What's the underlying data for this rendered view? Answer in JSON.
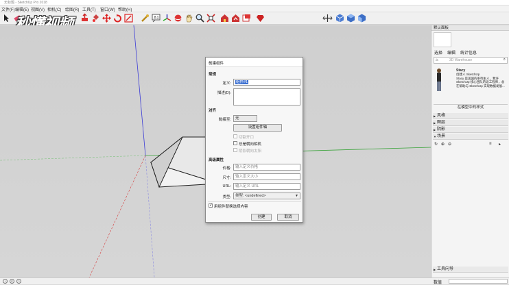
{
  "window": {
    "title": "无标题 - SketchUp Pro 2018"
  },
  "watermark": "秒懂视频",
  "menus": [
    "文件(F)",
    "编辑(E)",
    "视图(V)",
    "相机(C)",
    "绘图(R)",
    "工具(T)",
    "窗口(W)",
    "帮助(H)"
  ],
  "toolbar": {
    "icons": [
      "select-icon",
      "eraser-icon",
      "line-icon",
      "rectangle-icon",
      "circle-icon",
      "arc-icon",
      "push-pull-icon",
      "move-icon",
      "rotate-icon",
      "scale-icon",
      "offset-icon",
      "tape-measure-icon",
      "text-icon",
      "axes-icon",
      "paint-bucket-icon",
      "orbit-icon",
      "pan-icon",
      "zoom-icon",
      "zoom-extents-icon",
      "warehouse-icon",
      "extension-warehouse-icon",
      "layout-icon",
      "ruby-icon",
      "section-plane-icon",
      "view-iso-icon",
      "view-top-icon",
      "view-front-icon"
    ]
  },
  "default_tray": {
    "header": "默认面板",
    "entity_info_tabs": [
      "选择",
      "编辑",
      "统计信息"
    ],
    "search_placeholder": "3D Warehouse",
    "component_name": "Stacy",
    "component_desc": [
      "创建人 SketchUp",
      "Stacy 是美国的系列主人，我许",
      "SketchUp 核心团队的设工程师，总",
      "在帮助与 SketchUp 实现数据发展..."
    ],
    "model_dropdown": "在模型中的样式",
    "sections": [
      "风格",
      "图层",
      "阴影",
      "场景",
      "工具向导"
    ],
    "status_right": "数值"
  },
  "dialog": {
    "title": "创建组件",
    "sections": {
      "general": "常规",
      "alignment": "对齐",
      "advanced": "高级属性"
    },
    "labels": {
      "definition": "定义:",
      "description": "描述(D):",
      "glue_to": "黏接至:",
      "price": "价格:",
      "size": "尺寸:",
      "url": "URL:",
      "type": "类型:"
    },
    "definition_value": "组件#1",
    "glue_to_value": "无",
    "set_axes_button": "设置组件轴",
    "checkboxes": {
      "cut_opening": "切割开口",
      "always_face_camera": "总是朝向相机",
      "shadows_face_sun": "阴影朝向太阳",
      "replace_selection": "用组件替换选择内容"
    },
    "placeholders": {
      "price": "输入定义价格",
      "size": "输入定义大小",
      "url": "输入定义 URL"
    },
    "type_value": "类型: <undefined>",
    "create_button": "创建",
    "cancel_button": "取消"
  }
}
